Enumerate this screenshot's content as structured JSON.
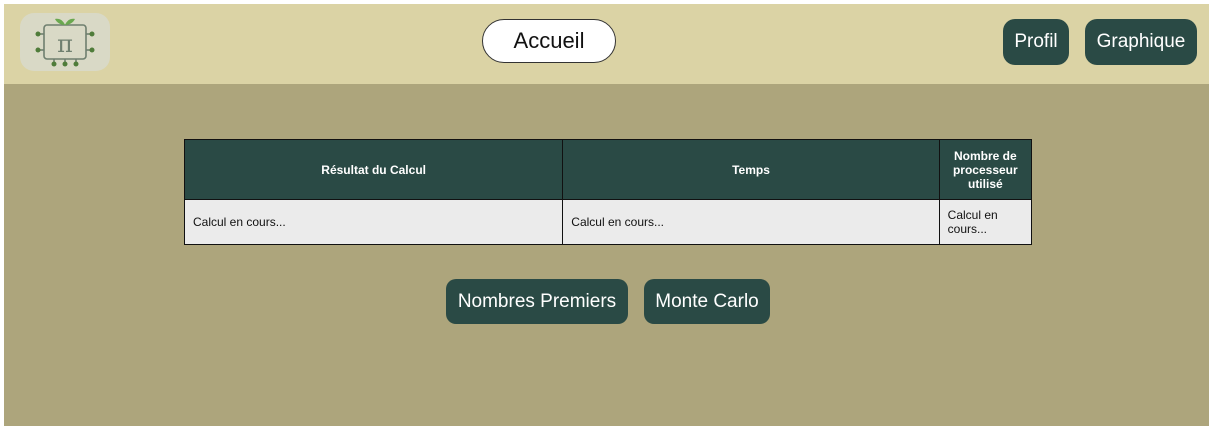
{
  "header": {
    "logo_icon": "pi-circuit-sprout-logo",
    "home_label": "Accueil",
    "profile_label": "Profil",
    "chart_label": "Graphique"
  },
  "table": {
    "columns": [
      "Résultat du Calcul",
      "Temps",
      "Nombre de processeur utilisé"
    ],
    "rows": [
      [
        "Calcul en cours...",
        "Calcul en cours...",
        "Calcul en cours..."
      ]
    ]
  },
  "actions": {
    "primes_label": "Nombres Premiers",
    "montecarlo_label": "Monte Carlo"
  },
  "colors": {
    "header_bg": "#dbd3a5",
    "page_bg": "#ada57c",
    "accent": "#2a4a45",
    "cell_bg": "#ebebeb"
  }
}
